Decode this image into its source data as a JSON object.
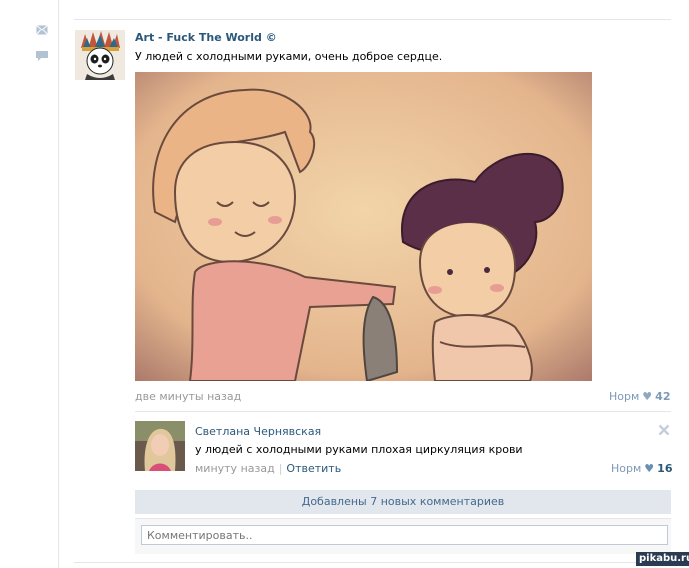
{
  "post": {
    "author": "Art - Fuck The World ©",
    "text": "У людей с холодными руками, очень доброе сердце.",
    "time": "две минуты назад",
    "like_label": "Норм",
    "like_count": "42"
  },
  "comment": {
    "author": "Светлана Чернявская",
    "text": "у людей с холодными руками плохая циркуляция крови",
    "time": "минуту назад",
    "reply_label": "Ответить",
    "like_label": "Норм",
    "like_count": "16"
  },
  "new_comments_label": "Добавлены 7 новых комментариев",
  "comment_input": {
    "placeholder": "Комментировать.."
  },
  "watermark": "pikabu.ru",
  "icons": [
    "mail-icon",
    "comment-icon",
    "heart-icon",
    "close-icon"
  ],
  "colors": {
    "link": "#2b587a",
    "muted": "#999999",
    "banner": "#e1e7ed"
  }
}
